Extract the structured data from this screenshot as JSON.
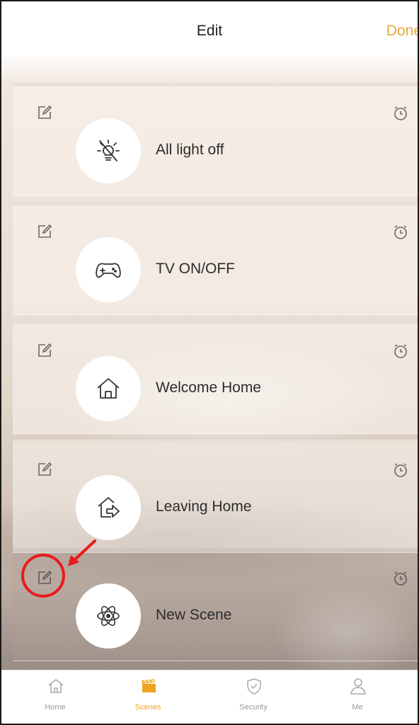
{
  "header": {
    "title": "Edit",
    "done_label": "Done"
  },
  "scenes": [
    {
      "label": "All light off",
      "icon": "light-off-icon"
    },
    {
      "label": "TV ON/OFF",
      "icon": "gamepad-icon"
    },
    {
      "label": "Welcome Home",
      "icon": "home-icon"
    },
    {
      "label": "Leaving Home",
      "icon": "leave-home-icon"
    },
    {
      "label": "New Scene",
      "icon": "atom-icon"
    }
  ],
  "tabbar": {
    "items": [
      {
        "label": "Home",
        "icon": "home-icon"
      },
      {
        "label": "Scenes",
        "icon": "clapperboard-icon",
        "active": true
      },
      {
        "label": "Security",
        "icon": "shield-icon"
      },
      {
        "label": "Me",
        "icon": "person-icon"
      }
    ]
  },
  "colors": {
    "accent": "#e8a93a",
    "active_tab": "#f0a21e",
    "annotation": "#ea1b1b"
  }
}
